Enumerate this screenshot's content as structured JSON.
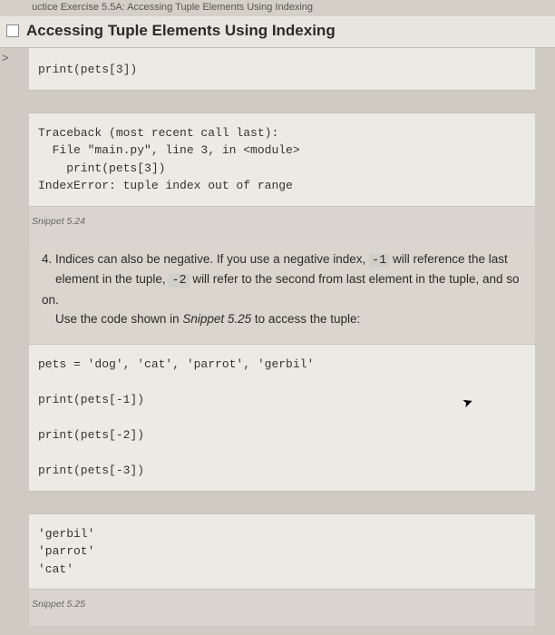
{
  "breadcrumb": "uctice Exercise 5.5A: Accessing Tuple Elements Using Indexing",
  "title": "Accessing Tuple Elements Using Indexing",
  "caret": ">",
  "codeBlock1": "print(pets[3])",
  "codeBlock2": "Traceback (most recent call last):\n  File \"main.py\", line 3, in <module>\n    print(pets[3])\nIndexError: tuple index out of range",
  "snippet1Label": "Snippet 5.24",
  "prose": {
    "num": "4.",
    "line1a": "Indices can also be negative. If you use a negative index, ",
    "neg1": "-1",
    "line1b": " will reference the last",
    "line2a": "element in the tuple, ",
    "neg2": "-2",
    "line2b": " will refer to the second from last element in the tuple, and so on.",
    "line3a": "Use the code shown in ",
    "ref": "Snippet 5.25",
    "line3b": " to access the tuple:"
  },
  "codeBlock3": "pets = 'dog', 'cat', 'parrot', 'gerbil'\n\nprint(pets[-1])\n\nprint(pets[-2])\n\nprint(pets[-3])",
  "codeBlock4": "'gerbil'\n'parrot'\n'cat'",
  "snippet2Label": "Snippet 5.25"
}
